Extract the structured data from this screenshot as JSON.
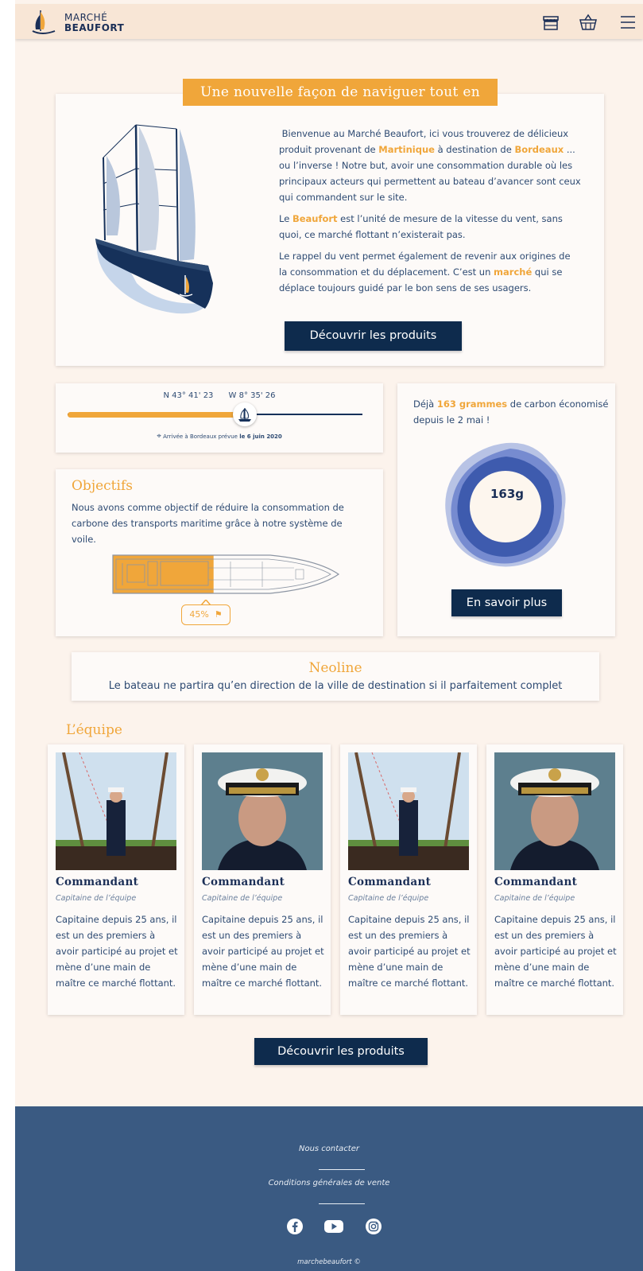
{
  "header": {
    "logo_line1": "MARCHÉ",
    "logo_line2": "BEAUFORT",
    "icons": [
      "shop-icon",
      "basket-icon",
      "menu-icon"
    ]
  },
  "intro": {
    "title": "Une nouvelle façon de naviguer tout en",
    "p1_a": "Bienvenue au Marché Beaufort, ici vous trouverez de délicieux produit provenant de ",
    "p1_hl1": "Martinique",
    "p1_b": " à destination de ",
    "p1_hl2": "Bordeaux",
    "p1_c": " ... ou l’inverse ! Notre but, avoir une consommation durable où les principaux acteurs qui permettent au bateau d’avancer sont ceux qui commandent sur le site.",
    "p2_a": "Le ",
    "p2_hl": "Beaufort",
    "p2_b": " est l’unité de mesure de la vitesse du vent, sans quoi, ce marché flottant n’existerait pas.",
    "p3_a": "Le rappel du vent permet également de revenir aux origines de la consommation et du déplacement. C’est un ",
    "p3_hl": "marché",
    "p3_b": " qui se déplace toujours guidé par le bon sens de ses usagers.",
    "button": "Découvrir les produits"
  },
  "voyage": {
    "lat": "N 43° 41' 23",
    "lon": "W 8° 35' 26",
    "progress": 0.6,
    "arrival_a": "Arrivée à Bordeaux prévue ",
    "arrival_date": "le 6 juin 2020"
  },
  "objectives": {
    "title": "Objectifs",
    "text": "Nous avons comme objectif de réduire la consommation de carbone des transports maritime grâce à notre système de voile.",
    "fill_percent": 0.45,
    "badge": "45%"
  },
  "carbon": {
    "text_a": "Déjà ",
    "text_hl": "163 grammes",
    "text_b": " de carbon économisé depuis le 2 mai !",
    "value": "163g",
    "button": "En savoir plus"
  },
  "neoline": {
    "title": "Neoline",
    "text": "Le bateau ne partira qu’en direction de la ville de destination si il parfaitement complet"
  },
  "team": {
    "title": "L’équipe",
    "members": [
      {
        "name": "Commandant",
        "role": "Capitaine de l’équipe",
        "desc": "Capitaine depuis 25 ans, il est un des premiers à avoir participé au projet et mène d’une main de maître ce marché flottant."
      },
      {
        "name": "Commandant",
        "role": "Capitaine de l’équipe",
        "desc": "Capitaine depuis 25 ans, il est un des premiers à avoir participé au projet et mène d’une main de maître ce marché flottant."
      },
      {
        "name": "Commandant",
        "role": "Capitaine de l’équipe",
        "desc": "Capitaine depuis 25 ans, il est un des premiers à avoir participé au projet et mène d’une main de maître ce marché flottant."
      },
      {
        "name": "Commandant",
        "role": "Capitaine de l’équipe",
        "desc": "Capitaine depuis 25 ans, il est un des premiers à avoir participé au projet et mène d’une main de maître ce marché flottant."
      }
    ],
    "button": "Découvrir les produits"
  },
  "footer": {
    "contact": "Nous contacter",
    "cgv": "Conditions générales de vente",
    "social": [
      "facebook-icon",
      "youtube-icon",
      "instagram-icon"
    ],
    "copyright": "marchebeaufort ©"
  },
  "colors": {
    "accent": "#f0a63a",
    "navy": "#0e2b4d",
    "text": "#2d4a72",
    "footer": "#3a5a82",
    "background": "#fcf3ec"
  }
}
